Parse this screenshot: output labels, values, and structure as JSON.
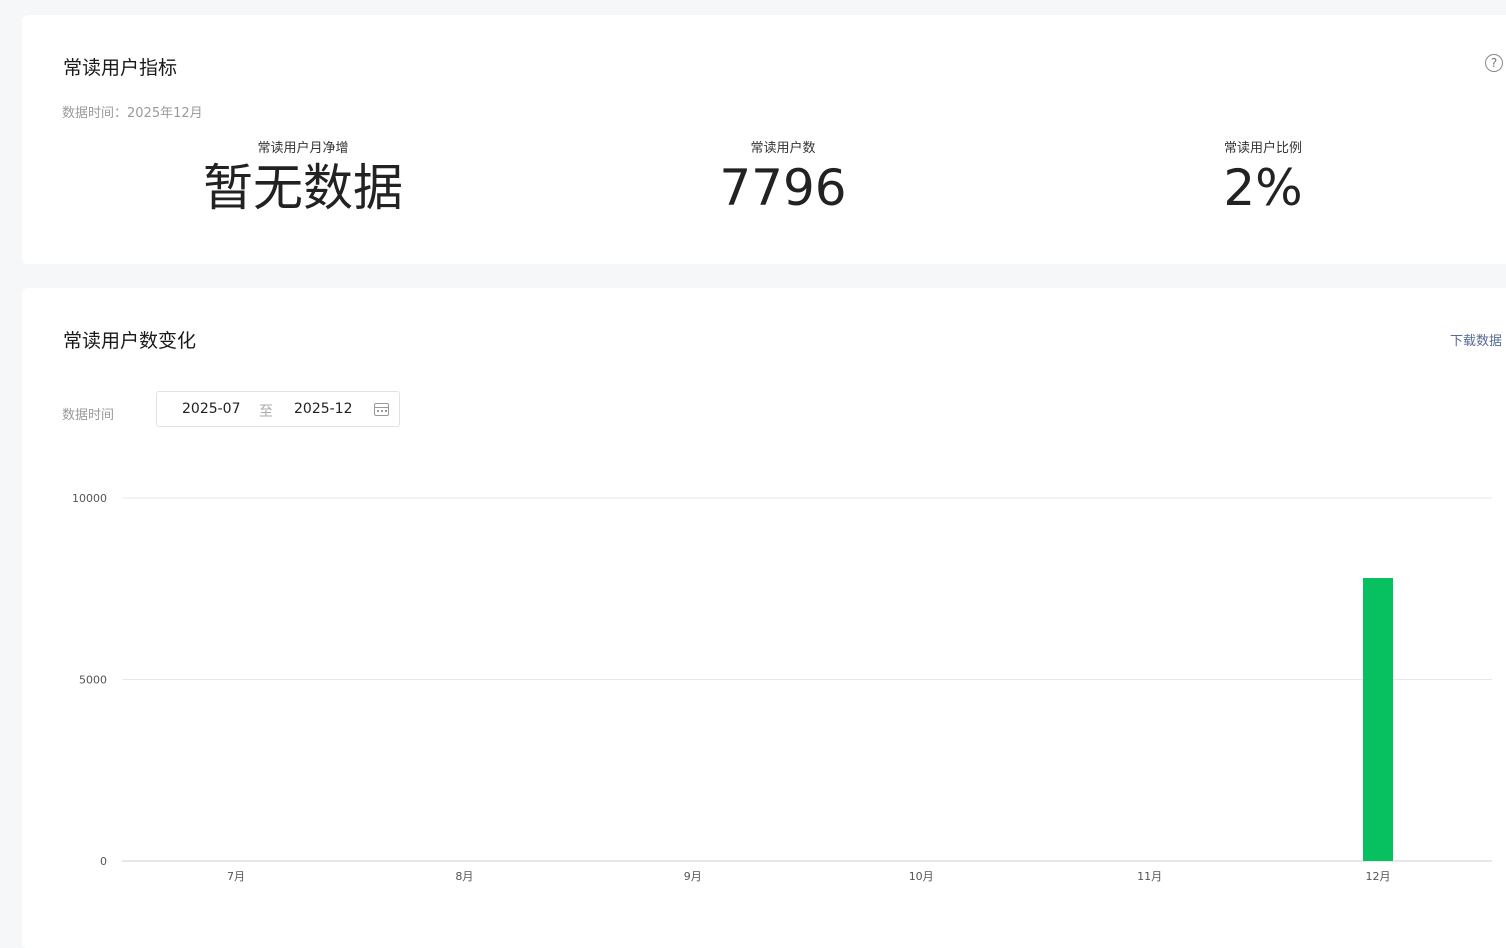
{
  "metrics": {
    "title": "常读用户指标",
    "data_time": "数据时间：2025年12月",
    "help_icon": "question-circle-icon",
    "items": [
      {
        "label": "常读用户月净增",
        "value": "暂无数据"
      },
      {
        "label": "常读用户数",
        "value": "7796"
      },
      {
        "label": "常读用户比例",
        "value": "2%"
      }
    ]
  },
  "trend": {
    "title": "常读用户数变化",
    "download_label": "下载数据",
    "filter_label": "数据时间",
    "date_start": "2025-07",
    "date_sep": "至",
    "date_end": "2025-12",
    "calendar_icon": "calendar-icon"
  },
  "chart_data": {
    "type": "bar",
    "categories": [
      "7月",
      "8月",
      "9月",
      "10月",
      "11月",
      "12月"
    ],
    "values": [
      0,
      0,
      0,
      0,
      0,
      7796
    ],
    "ylim": [
      0,
      10000
    ],
    "yticks": [
      0,
      5000,
      10000
    ],
    "bar_color": "#07c160",
    "grid": true
  }
}
